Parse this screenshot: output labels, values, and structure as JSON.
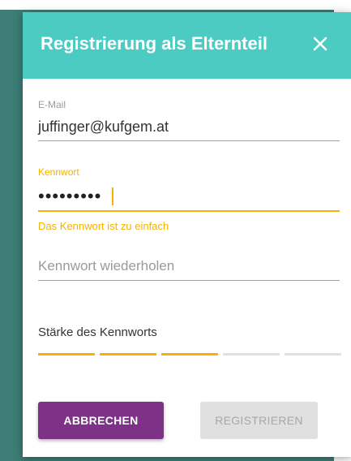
{
  "dialog": {
    "title": "Registrierung als Elternteil",
    "close_icon": "close-icon"
  },
  "email": {
    "label": "E-Mail",
    "value": "juffinger@kufgem.at"
  },
  "password": {
    "label": "Kennwort",
    "masked_value": "•••••••••",
    "error": "Das Kennwort ist zu einfach"
  },
  "password_repeat": {
    "placeholder": "Kennwort wiederholen"
  },
  "strength": {
    "label": "Stärke des Kennworts",
    "segments_total": 5,
    "segments_filled": 3
  },
  "buttons": {
    "cancel": "ABBRECHEN",
    "register": "REGISTRIEREN"
  },
  "colors": {
    "header": "#4ccbc3",
    "accent_warning": "#f5b300",
    "cancel_button": "#7d3288",
    "backdrop": "#3c7d76"
  }
}
